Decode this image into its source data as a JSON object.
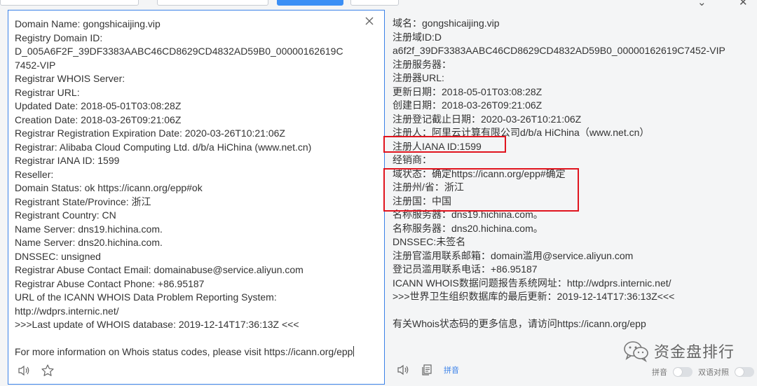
{
  "source": {
    "lines": [
      "Domain Name: gongshicaijing.vip",
      "Registry Domain ID:",
      "D_005A6F2F_39DF3383AABC46CD8629CD4832AD59B0_00000162619C",
      "7452-VIP",
      "Registrar WHOIS Server:",
      "Registrar URL:",
      "Updated Date: 2018-05-01T03:08:28Z",
      "Creation Date: 2018-03-26T09:21:06Z",
      "Registrar Registration Expiration Date: 2020-03-26T10:21:06Z",
      "Registrar: Alibaba Cloud Computing Ltd. d/b/a HiChina (www.net.cn)",
      "Registrar IANA ID: 1599",
      "Reseller:",
      "Domain Status: ok https://icann.org/epp#ok",
      "Registrant State/Province: 浙江",
      "Registrant Country: CN",
      "Name Server: dns19.hichina.com.",
      "Name Server: dns20.hichina.com.",
      "DNSSEC: unsigned",
      "Registrar Abuse Contact Email: domainabuse@service.aliyun.com",
      "Registrar Abuse Contact Phone: +86.95187",
      "URL of the ICANN WHOIS Data Problem Reporting System:",
      "http://wdprs.internic.net/",
      ">>>Last update of WHOIS database: 2019-12-14T17:36:13Z <<<",
      "",
      "For more information on Whois status codes, please visit https://icann.org/epp"
    ]
  },
  "target": {
    "lines": [
      "域名：gongshicaijing.vip",
      "注册域ID:D",
      "a6f2f_39DF3383AABC46CD8629CD4832AD59B0_00000162619C7452-VIP",
      "注册服务器：",
      "注册器URL:",
      "更新日期：2018-05-01T03:08:28Z",
      "创建日期：2018-03-26T09:21:06Z",
      "注册登记截止日期：2020-03-26T10:21:06Z",
      "注册人：阿里云计算有限公司d/b/a HiChina（www.net.cn）",
      "注册人IANA ID:1599",
      "经销商：",
      "域状态：确定https://icann.org/epp#确定",
      "注册州/省：浙江",
      "注册国：中国",
      "名称服务器：dns19.hichina.com。",
      "名称服务器：dns20.hichina.com。",
      "DNSSEC:未签名",
      "注册官滥用联系邮箱：domain滥用@service.aliyun.com",
      "登记员滥用联系电话：+86.95187",
      "ICANN WHOIS数据问题报告系统网址：http://wdprs.internic.net/",
      ">>>世界卫生组织数据库的最后更新：2019-12-14T17:36:13Z<<<",
      "",
      "有关Whois状态码的更多信息，请访问https://icann.org/epp"
    ],
    "pinyin_link": "拼音",
    "toggle_pinyin": "拼音",
    "toggle_bilingual": "双语对照"
  },
  "watermark": "资金盘排行",
  "colors": {
    "accent": "#3b82e8",
    "highlight": "#e0141e",
    "panel_bg": "#f4f5f6"
  },
  "icons": [
    "close-icon",
    "speaker-icon",
    "star-icon",
    "copy-icon",
    "wechat-icon"
  ]
}
